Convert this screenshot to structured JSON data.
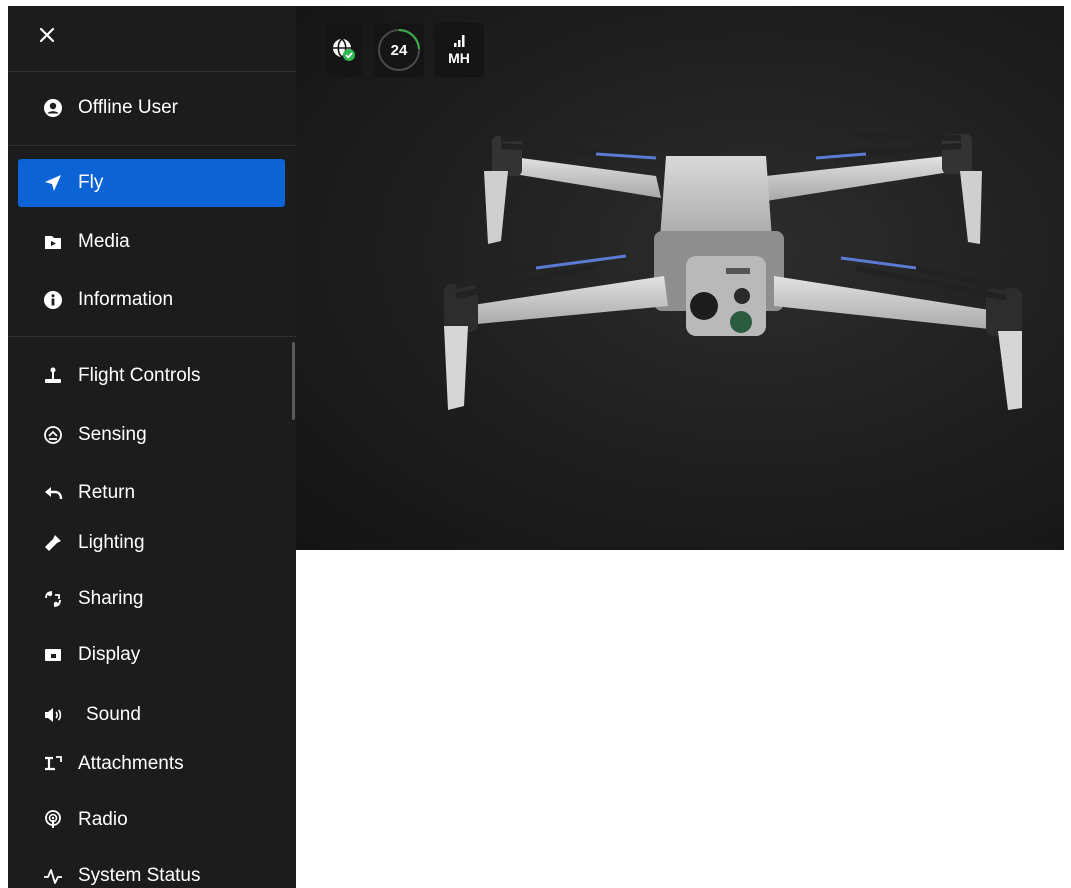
{
  "menu": {
    "close_icon": "close-icon",
    "user": {
      "label": "Offline User",
      "icon": "user-circle-icon"
    },
    "primary": [
      {
        "label": "Fly",
        "icon": "navigation-arrow-icon",
        "active": true
      },
      {
        "label": "Media",
        "icon": "media-icon",
        "active": false
      },
      {
        "label": "Information",
        "icon": "info-icon",
        "active": false
      }
    ],
    "settings": [
      {
        "label": "Flight Controls",
        "icon": "joystick-icon"
      },
      {
        "label": "Sensing",
        "icon": "sensing-icon"
      },
      {
        "label": "Return",
        "icon": "return-arrow-icon"
      },
      {
        "label": "Lighting",
        "icon": "flashlight-icon"
      },
      {
        "label": "Sharing",
        "icon": "sharing-icon"
      },
      {
        "label": "Display",
        "icon": "display-icon"
      },
      {
        "label": "Sound",
        "icon": "speaker-icon"
      },
      {
        "label": "Attachments",
        "icon": "attachment-icon"
      },
      {
        "label": "Radio",
        "icon": "radio-icon"
      },
      {
        "label": "System Status",
        "icon": "pulse-icon"
      }
    ]
  },
  "hud": {
    "gps_icon": "globe-check-icon",
    "battery": {
      "value": "24",
      "level": 0.24
    },
    "signal": {
      "label": "MH",
      "icon": "signal-bars-icon"
    }
  },
  "colors": {
    "active": "#0b63d6",
    "sidebar": "#1c1c1c",
    "battery_ring": "#3ea84a",
    "check": "#2fb84f"
  }
}
